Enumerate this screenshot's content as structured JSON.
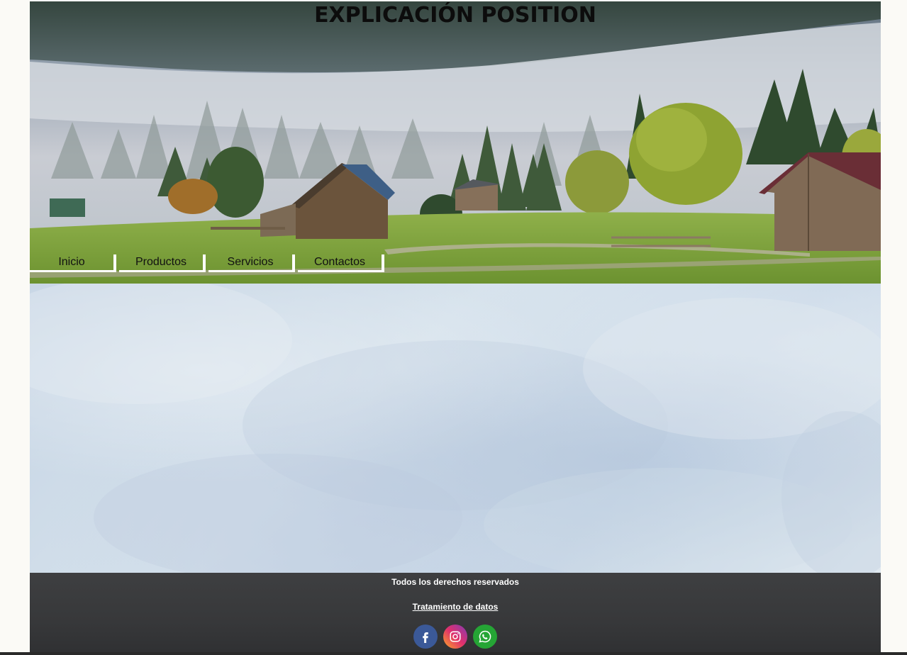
{
  "header": {
    "title": "EXPLICACIÓN POSITION",
    "image_icon": "landscape-photo-icon"
  },
  "nav": {
    "items": [
      {
        "label": "Inicio"
      },
      {
        "label": "Productos"
      },
      {
        "label": "Servicios"
      },
      {
        "label": "Contactos"
      }
    ]
  },
  "footer": {
    "rights": "Todos los derechos reservados",
    "privacy_link": "Tratamiento de datos",
    "social": [
      {
        "icon": "facebook-icon",
        "color": "#3b5998"
      },
      {
        "icon": "instagram-icon",
        "color": "#e1306c"
      },
      {
        "icon": "whatsapp-icon",
        "color": "#25a535"
      }
    ]
  },
  "colors": {
    "page_background": "#fbfaf6",
    "footer_background": "#3e3f41",
    "main_background": "#cdd9e6"
  }
}
